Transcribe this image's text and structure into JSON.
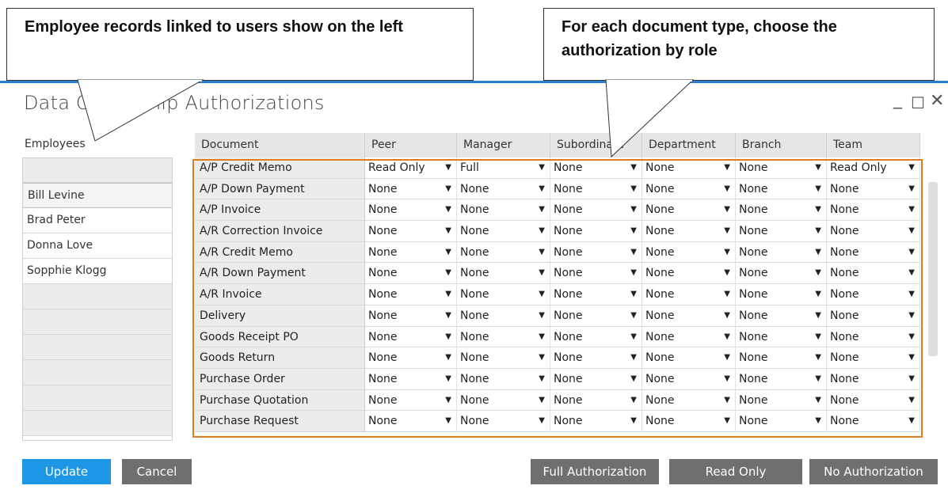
{
  "callouts": {
    "left": "Employee records linked to users show on the left",
    "right": "For each document type, choose the authorization by role"
  },
  "window": {
    "title": "Data Ownership Authorizations",
    "min_glyph": "_",
    "max_glyph": "☐",
    "close_glyph": "✕"
  },
  "employees": {
    "label": "Employees",
    "items": [
      "Bill Levine",
      "Brad Peter",
      "Donna Love",
      "Sopphie Klogg"
    ]
  },
  "grid": {
    "headers": [
      "Document",
      "Peer",
      "Manager",
      "Subordinate",
      "Department",
      "Branch",
      "Team"
    ],
    "rows": [
      {
        "doc": "A/P Credit Memo",
        "vals": [
          "Read Only",
          "Full",
          "None",
          "None",
          "None",
          "Read Only"
        ]
      },
      {
        "doc": "A/P Down Payment",
        "vals": [
          "None",
          "None",
          "None",
          "None",
          "None",
          "None"
        ]
      },
      {
        "doc": "A/P Invoice",
        "vals": [
          "None",
          "None",
          "None",
          "None",
          "None",
          "None"
        ]
      },
      {
        "doc": "A/R Correction Invoice",
        "vals": [
          "None",
          "None",
          "None",
          "None",
          "None",
          "None"
        ]
      },
      {
        "doc": "A/R Credit Memo",
        "vals": [
          "None",
          "None",
          "None",
          "None",
          "None",
          "None"
        ]
      },
      {
        "doc": "A/R Down Payment",
        "vals": [
          "None",
          "None",
          "None",
          "None",
          "None",
          "None"
        ]
      },
      {
        "doc": "A/R Invoice",
        "vals": [
          "None",
          "None",
          "None",
          "None",
          "None",
          "None"
        ]
      },
      {
        "doc": "Delivery",
        "vals": [
          "None",
          "None",
          "None",
          "None",
          "None",
          "None"
        ]
      },
      {
        "doc": "Goods Receipt PO",
        "vals": [
          "None",
          "None",
          "None",
          "None",
          "None",
          "None"
        ]
      },
      {
        "doc": "Goods Return",
        "vals": [
          "None",
          "None",
          "None",
          "None",
          "None",
          "None"
        ]
      },
      {
        "doc": "Purchase Order",
        "vals": [
          "None",
          "None",
          "None",
          "None",
          "None",
          "None"
        ]
      },
      {
        "doc": "Purchase Quotation",
        "vals": [
          "None",
          "None",
          "None",
          "None",
          "None",
          "None"
        ]
      },
      {
        "doc": "Purchase Request",
        "vals": [
          "None",
          "None",
          "None",
          "None",
          "None",
          "None"
        ]
      }
    ]
  },
  "buttons": {
    "update": "Update",
    "cancel": "Cancel",
    "full_authorization": "Full Authorization",
    "read_only": "Read Only",
    "no_authorization": "No Authorization"
  },
  "colors": {
    "accent": "#1e96e6",
    "highlight_border": "#e07b20",
    "button_gray": "#6f6f6f"
  }
}
